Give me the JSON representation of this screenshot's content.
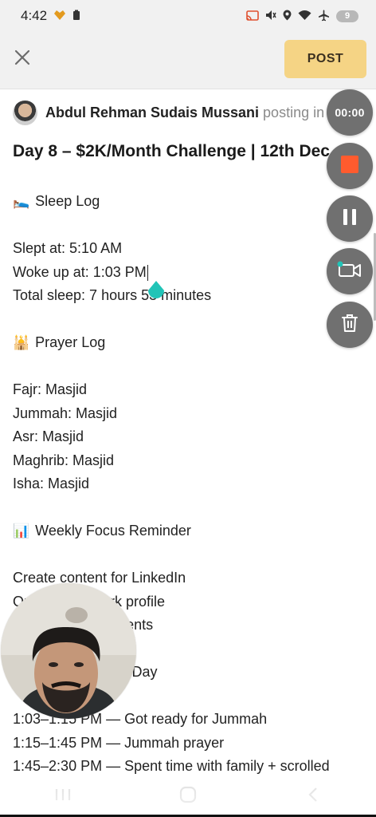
{
  "status_bar": {
    "time": "4:42",
    "battery": "9",
    "icons": [
      "heart-badge-icon",
      "battery-saver-icon",
      "cast-icon",
      "mute-icon",
      "location-icon",
      "wifi-icon",
      "airplane-icon"
    ]
  },
  "header": {
    "close_icon": "close-icon",
    "post_label": "POST",
    "post_color": "#f5d485"
  },
  "post": {
    "author": "Abdul Rehman Sudais Mussani",
    "posting_in": "posting in",
    "title": "Day 8 – $2K/Month Challenge | 12th Dec",
    "lines": [
      {
        "emoji": "🛌",
        "text": "Sleep Log"
      },
      {
        "text": ""
      },
      {
        "text": "Slept at: 5:10 AM"
      },
      {
        "text": "Woke up at: 1:03 PM",
        "cursor": true
      },
      {
        "text": "Total sleep: 7 hours 53 minutes"
      },
      {
        "text": ""
      },
      {
        "emoji": "🕌",
        "text": "Prayer Log"
      },
      {
        "text": ""
      },
      {
        "text": "Fajr: Masjid"
      },
      {
        "text": "Jummah: Masjid"
      },
      {
        "text": "Asr: Masjid"
      },
      {
        "text": "Maghrib: Masjid"
      },
      {
        "text": "Isha: Masjid"
      },
      {
        "text": ""
      },
      {
        "emoji": "📊",
        "text": "Weekly Focus Reminder"
      },
      {
        "text": ""
      },
      {
        "text": "Create content for LinkedIn"
      },
      {
        "text": "Optimize Upwork profile"
      },
      {
        "text": "Learn about AI agents"
      },
      {
        "text": ""
      },
      {
        "text": "⏰ Timeline of the Day"
      },
      {
        "text": ""
      },
      {
        "text": "1:03–1:15 PM — Got ready for Jummah"
      },
      {
        "text": "1:15–1:45 PM — Jummah prayer"
      },
      {
        "text": "1:45–2:30 PM — Spent time with family + scrolled"
      }
    ]
  },
  "recorder": {
    "timer": "00:00",
    "stop_color": "#ff5b2e",
    "buttons": [
      "timer",
      "stop-icon",
      "pause-icon",
      "camera-toggle-icon",
      "trash-icon"
    ]
  },
  "nav_bar": {
    "icons": [
      "recent-apps-icon",
      "home-icon",
      "back-icon"
    ]
  }
}
